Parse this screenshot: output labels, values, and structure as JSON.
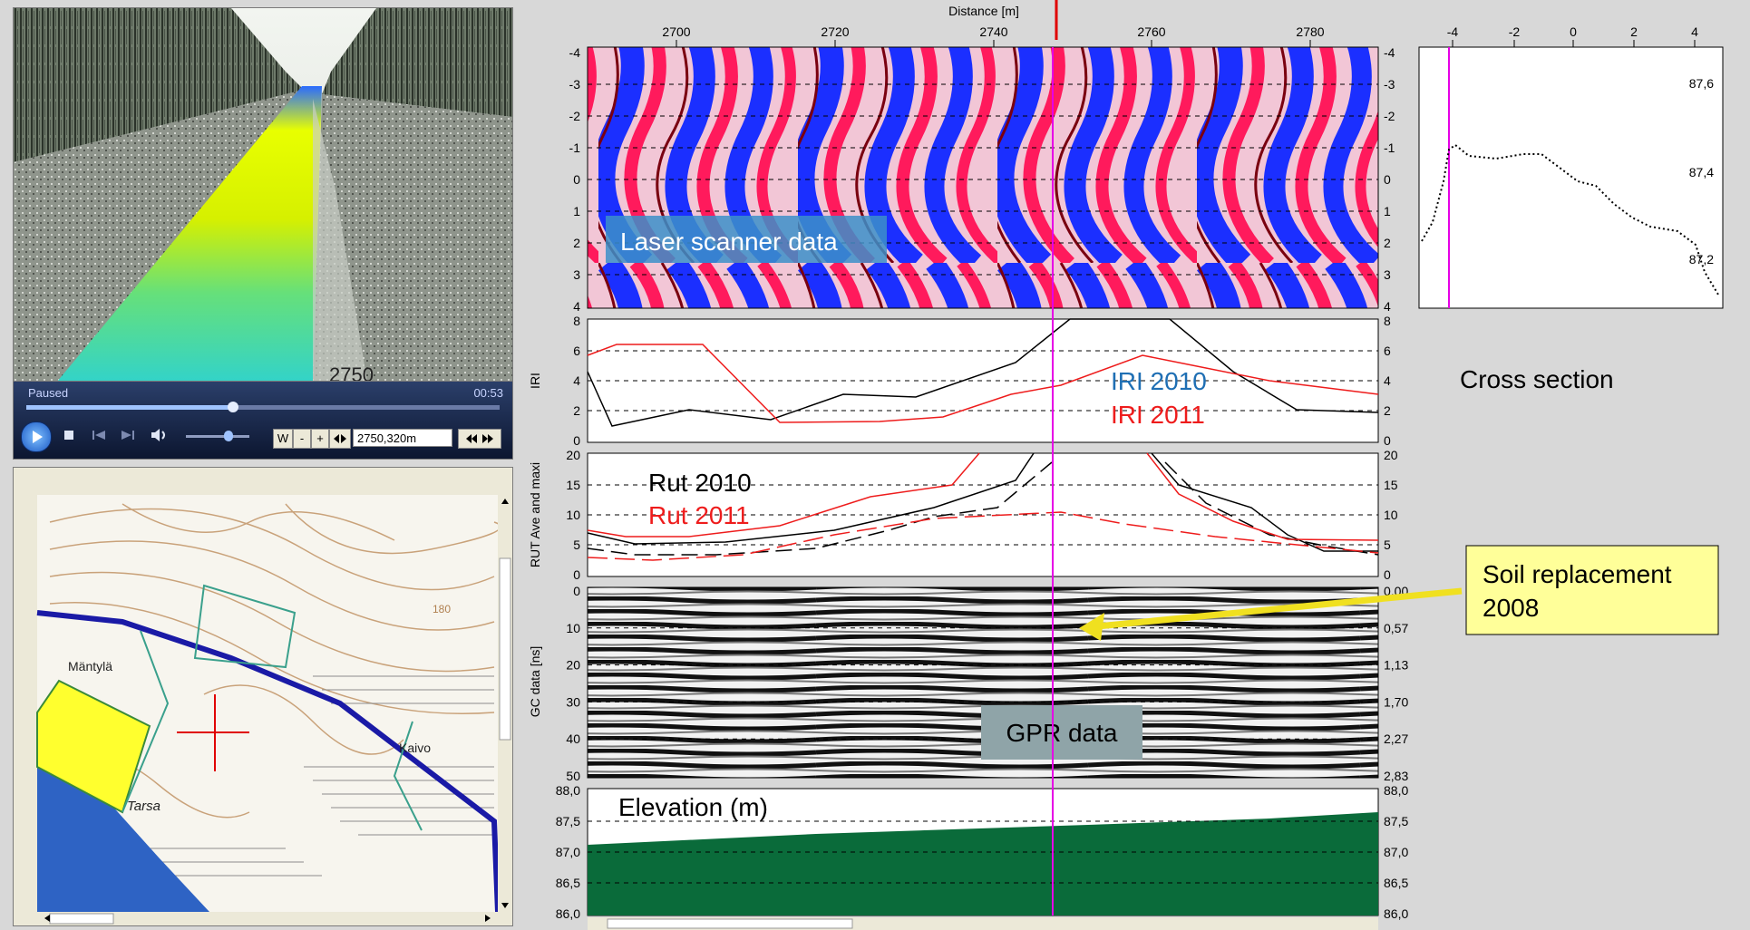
{
  "video": {
    "status": "Paused",
    "time": "00:53",
    "position_field": "2750,320m",
    "road_marker": "2750",
    "buttons": {
      "w": "W",
      "minus": "-",
      "plus": "+"
    }
  },
  "map": {
    "place_1": "Mäntylä",
    "place_2": "Kaivo",
    "place_3": "Tarsa",
    "place_4": "180"
  },
  "top_axis": {
    "title": "Distance [m]",
    "ticks": [
      "2700",
      "2720",
      "2740",
      "2760",
      "2780"
    ]
  },
  "laser": {
    "label": "Laser scanner data",
    "ticks": [
      "-4",
      "-3",
      "-2",
      "-1",
      "0",
      "1",
      "2",
      "3",
      "4"
    ]
  },
  "iri": {
    "ylabel": "IRI",
    "ticks": [
      "8",
      "6",
      "4",
      "2",
      "0"
    ],
    "label_2010": "IRI 2010",
    "label_2011": "IRI 2011",
    "color_2010": "#1f6fb4",
    "color_2011": "#ee1c1c"
  },
  "rut": {
    "ylabel": "RUT Ave and maxi",
    "ticks": [
      "20",
      "15",
      "10",
      "5",
      "0"
    ],
    "label_2010": "Rut 2010",
    "label_2011": "Rut 2011"
  },
  "gpr": {
    "ylabel": "GC data [ns]",
    "ticks_left": [
      "0",
      "10",
      "20",
      "30",
      "40",
      "50"
    ],
    "ticks_right": [
      "0,00",
      "0,57",
      "1,13",
      "1,70",
      "2,27",
      "2,83"
    ],
    "label": "GPR data"
  },
  "elevation": {
    "label": "Elevation (m)",
    "ticks": [
      "88,0",
      "87,5",
      "87,0",
      "86,5",
      "86,0"
    ]
  },
  "cross_section": {
    "label": "Cross section",
    "xticks": [
      "-4",
      "-2",
      "0",
      "2",
      "4"
    ],
    "yticks": [
      "87,6",
      "87,4",
      "87,2"
    ]
  },
  "callout": {
    "text_line1": "Soil replacement",
    "text_line2": "2008"
  },
  "colors": {
    "marker_line": "#e600e6",
    "elevation_fill": "#0a6b3a",
    "callout_bg": "#ffff99",
    "callout_arrow": "#f0e020"
  }
}
